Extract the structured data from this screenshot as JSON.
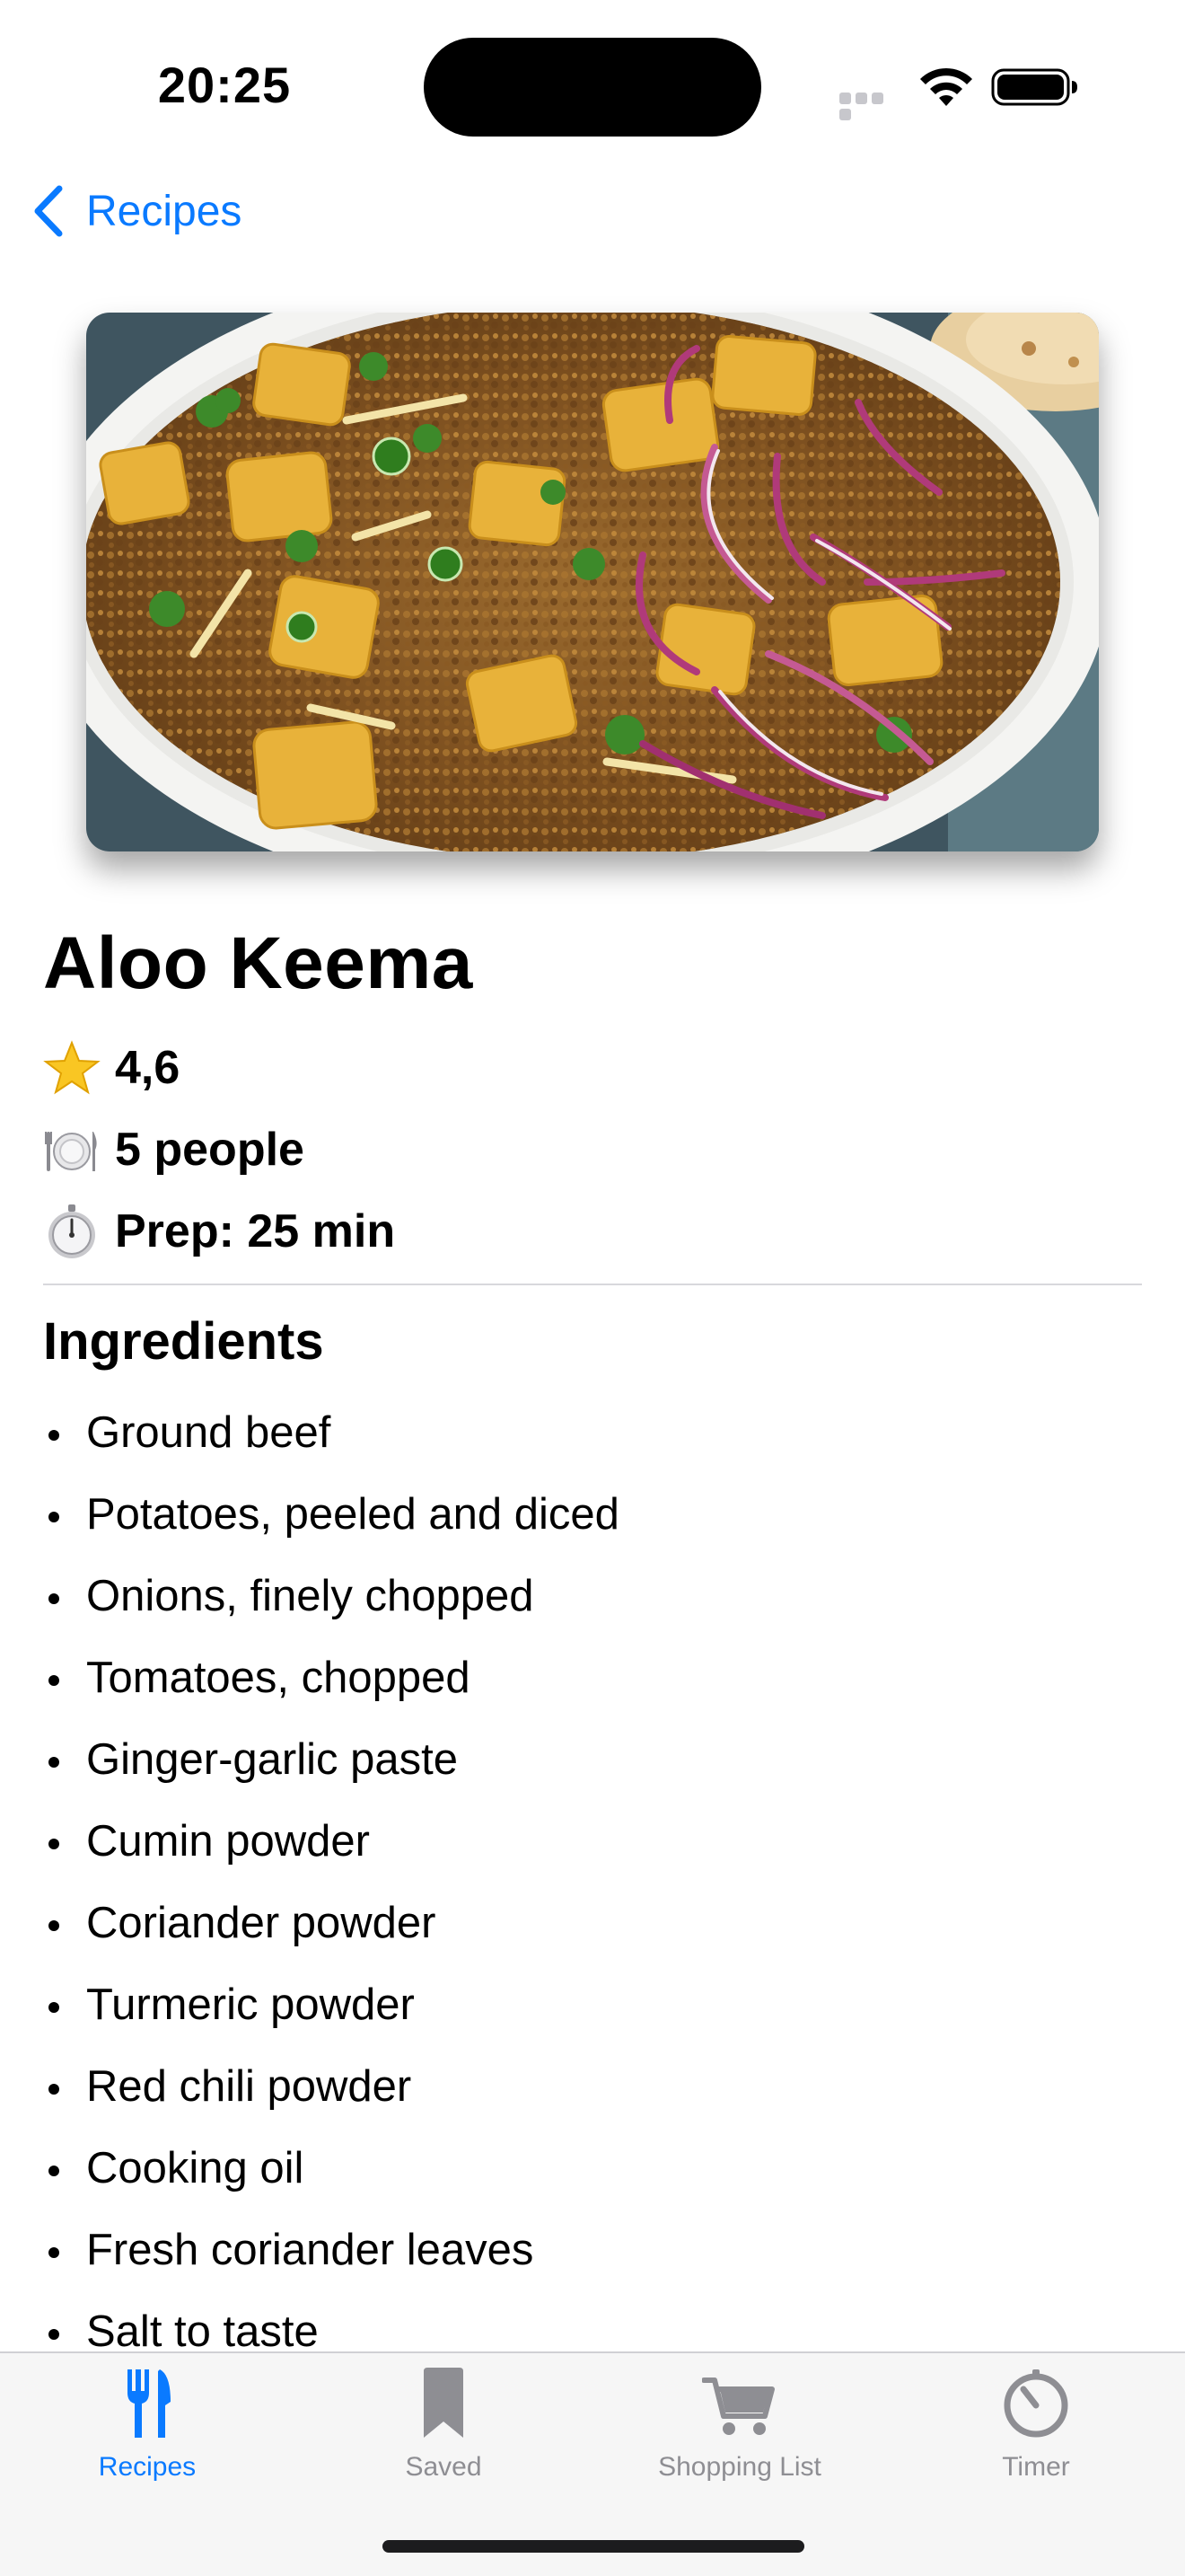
{
  "status_bar": {
    "time": "20:25",
    "icons": [
      "cellular-signal-icon",
      "wifi-icon",
      "battery-icon"
    ]
  },
  "nav": {
    "back_label": "Recipes",
    "back_icon": "chevron-left-icon",
    "accent_color": "#0a7aff"
  },
  "hero": {
    "image": "aloo-keema-photo"
  },
  "recipe": {
    "title": "Aloo Keema",
    "rating": "4,6",
    "rating_icon": "star-icon",
    "servings": "5 people",
    "servings_icon": "plate-cutlery-icon",
    "prep": "Prep: 25 min",
    "prep_icon": "stopwatch-icon"
  },
  "ingredients": {
    "title": "Ingredients",
    "items": [
      "Ground beef",
      "Potatoes, peeled and diced",
      "Onions, finely chopped",
      "Tomatoes, chopped",
      "Ginger-garlic paste",
      "Cumin powder",
      "Coriander powder",
      "Turmeric powder",
      "Red chili powder",
      "Cooking oil",
      "Fresh coriander leaves",
      "Salt to taste"
    ]
  },
  "tab_bar": {
    "tabs": [
      {
        "label": "Recipes",
        "icon": "fork-knife-icon",
        "active": true
      },
      {
        "label": "Saved",
        "icon": "bookmark-icon",
        "active": false
      },
      {
        "label": "Shopping List",
        "icon": "cart-icon",
        "active": false
      },
      {
        "label": "Timer",
        "icon": "timer-icon",
        "active": false
      }
    ],
    "active_color": "#0a7aff",
    "inactive_color": "#8e8e93"
  }
}
